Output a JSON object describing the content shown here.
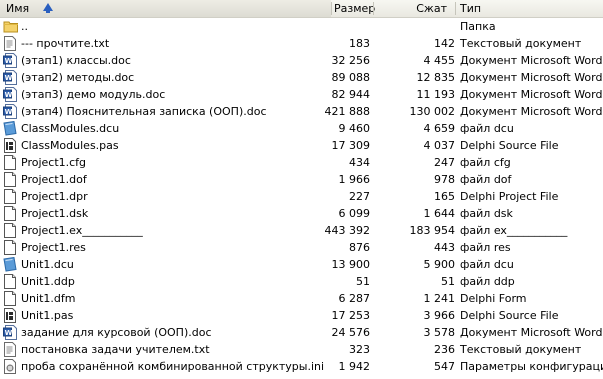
{
  "columns": {
    "name": "Имя",
    "size": "Размер",
    "packed": "Сжат",
    "type": "Тип"
  },
  "rows": [
    {
      "icon": "folder-up-icon",
      "name": "..",
      "size": "",
      "packed": "",
      "type": "Папка"
    },
    {
      "icon": "text-file-icon",
      "name": "--- прочтите.txt",
      "size": "183",
      "packed": "142",
      "type": "Текстовый документ"
    },
    {
      "icon": "word-doc-icon",
      "name": "(этап1) классы.doc",
      "size": "32 256",
      "packed": "4 455",
      "type": "Документ Microsoft Word"
    },
    {
      "icon": "word-doc-icon",
      "name": "(этап2) методы.doc",
      "size": "89 088",
      "packed": "12 835",
      "type": "Документ Microsoft Word"
    },
    {
      "icon": "word-doc-icon",
      "name": "(этап3) демо модуль.doc",
      "size": "82 944",
      "packed": "11 193",
      "type": "Документ Microsoft Word"
    },
    {
      "icon": "word-doc-icon",
      "name": "(этап4) Пояснительная записка (ООП).doc",
      "size": "421 888",
      "packed": "130 002",
      "type": "Документ Microsoft Word"
    },
    {
      "icon": "dcu-file-icon",
      "name": "ClassModules.dcu",
      "size": "9 460",
      "packed": "4 659",
      "type": "файл dcu"
    },
    {
      "icon": "pas-file-icon",
      "name": "ClassModules.pas",
      "size": "17 309",
      "packed": "4 037",
      "type": "Delphi Source File"
    },
    {
      "icon": "blank-file-icon",
      "name": "Project1.cfg",
      "size": "434",
      "packed": "247",
      "type": "файл cfg"
    },
    {
      "icon": "blank-file-icon",
      "name": "Project1.dof",
      "size": "1 966",
      "packed": "978",
      "type": "файл dof"
    },
    {
      "icon": "blank-file-icon",
      "name": "Project1.dpr",
      "size": "227",
      "packed": "165",
      "type": "Delphi Project File"
    },
    {
      "icon": "blank-file-icon",
      "name": "Project1.dsk",
      "size": "6 099",
      "packed": "1 644",
      "type": "файл dsk"
    },
    {
      "icon": "blank-file-icon",
      "name": "Project1.ex___________",
      "size": "443 392",
      "packed": "183 954",
      "type": "файл ex___________"
    },
    {
      "icon": "blank-file-icon",
      "name": "Project1.res",
      "size": "876",
      "packed": "443",
      "type": "файл res"
    },
    {
      "icon": "dcu-file-icon",
      "name": "Unit1.dcu",
      "size": "13 900",
      "packed": "5 900",
      "type": "файл dcu"
    },
    {
      "icon": "blank-file-icon",
      "name": "Unit1.ddp",
      "size": "51",
      "packed": "51",
      "type": "файл ddp"
    },
    {
      "icon": "blank-file-icon",
      "name": "Unit1.dfm",
      "size": "6 287",
      "packed": "1 241",
      "type": "Delphi Form"
    },
    {
      "icon": "pas-file-icon",
      "name": "Unit1.pas",
      "size": "17 253",
      "packed": "3 966",
      "type": "Delphi Source File"
    },
    {
      "icon": "word-doc-icon",
      "name": "задание для курсовой (ООП).doc",
      "size": "24 576",
      "packed": "3 578",
      "type": "Документ Microsoft Word"
    },
    {
      "icon": "text-file-icon",
      "name": "постановка задачи учителем.txt",
      "size": "323",
      "packed": "236",
      "type": "Текстовый документ"
    },
    {
      "icon": "ini-file-icon",
      "name": "проба сохранённой комбинированной структуры.ini",
      "size": "1 942",
      "packed": "547",
      "type": "Параметры конфигурации"
    }
  ]
}
